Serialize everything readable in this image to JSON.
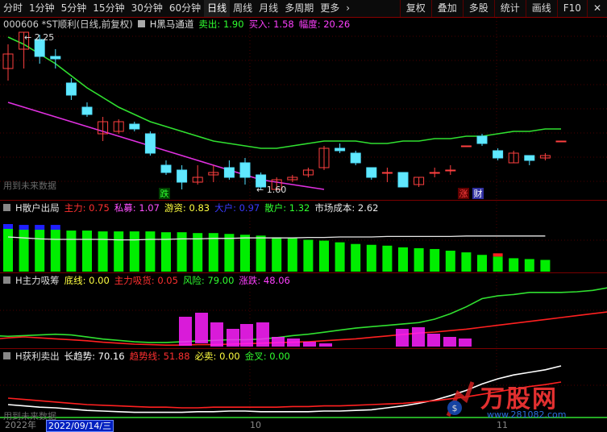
{
  "toolbar": {
    "periods": [
      "分时",
      "1分钟",
      "5分钟",
      "15分钟",
      "30分钟",
      "60分钟",
      "日线",
      "周线",
      "月线",
      "多周期",
      "更多"
    ],
    "active_period": "日线",
    "more_arrow": "›",
    "right_buttons": [
      "复权",
      "叠加",
      "多股",
      "统计",
      "画线",
      "F10"
    ],
    "close": "✕"
  },
  "main_panel": {
    "stock": "000606 *ST顺利(日线,前复权)",
    "indicator": "H黑马通道",
    "sell_label": "卖出: 1.90",
    "buy_label": "买入: 1.58",
    "range_label": "幅度: 20.26",
    "high_mark": "2.25",
    "low_mark": "1.60",
    "tag_die": "跌",
    "tag_zhang": "涨",
    "tag_cai": "财",
    "watermark": "用到未来数据"
  },
  "panel2": {
    "title": "H散户出局",
    "items": [
      {
        "label": "主力: 0.75",
        "color": "#ff3030"
      },
      {
        "label": "私募: 1.07",
        "color": "#ff50ff"
      },
      {
        "label": "游资: 0.83",
        "color": "#ffff40"
      },
      {
        "label": "大户: 0.97",
        "color": "#3a3aff"
      },
      {
        "label": "散户: 1.32",
        "color": "#30ff30"
      },
      {
        "label": "市场成本: 2.62",
        "color": "#e8e8e8"
      }
    ]
  },
  "panel3": {
    "title": "H主力吸筹",
    "items": [
      {
        "label": "底线: 0.00",
        "color": "#ffff40"
      },
      {
        "label": "主力吸货: 0.05",
        "color": "#ff3030"
      },
      {
        "label": "风险: 79.00",
        "color": "#30ff30"
      },
      {
        "label": "涨跌: 48.06",
        "color": "#ff40ff"
      }
    ]
  },
  "panel4": {
    "title": "H获利卖出",
    "items": [
      {
        "label": "长趋势: 70.16",
        "color": "#ffffff"
      },
      {
        "label": "趋势线: 51.88",
        "color": "#ff3030"
      },
      {
        "label": "必卖: 0.00",
        "color": "#ffff40"
      },
      {
        "label": "金叉: 0.00",
        "color": "#30ff30"
      }
    ],
    "watermark": "用到未来数据"
  },
  "footer": {
    "year": "2022年",
    "date": "2022/09/14/三",
    "month_mark": "10",
    "month_mark2": "11"
  },
  "logo": {
    "brand": "万股网",
    "url": "www.281082.com"
  },
  "chart_data": {
    "type": "candlestick",
    "candles": [
      {
        "o": 2.1,
        "c": 2.16,
        "h": 2.2,
        "l": 2.05
      },
      {
        "o": 2.18,
        "c": 2.25,
        "h": 2.25,
        "l": 2.1
      },
      {
        "o": 2.22,
        "c": 2.15,
        "h": 2.24,
        "l": 2.12
      },
      {
        "o": 2.15,
        "c": 2.14,
        "h": 2.18,
        "l": 2.1
      },
      {
        "o": 2.04,
        "c": 1.99,
        "h": 2.06,
        "l": 1.97
      },
      {
        "o": 1.94,
        "c": 1.91,
        "h": 1.96,
        "l": 1.9
      },
      {
        "o": 1.83,
        "c": 1.88,
        "h": 1.9,
        "l": 1.8
      },
      {
        "o": 1.84,
        "c": 1.88,
        "h": 1.89,
        "l": 1.83
      },
      {
        "o": 1.87,
        "c": 1.85,
        "h": 1.88,
        "l": 1.84
      },
      {
        "o": 1.83,
        "c": 1.75,
        "h": 1.84,
        "l": 1.74
      },
      {
        "o": 1.7,
        "c": 1.67,
        "h": 1.72,
        "l": 1.66
      },
      {
        "o": 1.68,
        "c": 1.63,
        "h": 1.7,
        "l": 1.6
      },
      {
        "o": 1.63,
        "c": 1.65,
        "h": 1.7,
        "l": 1.62
      },
      {
        "o": 1.66,
        "c": 1.67,
        "h": 1.7,
        "l": 1.63
      },
      {
        "o": 1.69,
        "c": 1.65,
        "h": 1.72,
        "l": 1.64
      },
      {
        "o": 1.71,
        "c": 1.65,
        "h": 1.73,
        "l": 1.62
      },
      {
        "o": 1.66,
        "c": 1.61,
        "h": 1.67,
        "l": 1.6
      },
      {
        "o": 1.6,
        "c": 1.64,
        "h": 1.65,
        "l": 1.6
      },
      {
        "o": 1.64,
        "c": 1.65,
        "h": 1.66,
        "l": 1.63
      },
      {
        "o": 1.66,
        "c": 1.68,
        "h": 1.69,
        "l": 1.65
      },
      {
        "o": 1.69,
        "c": 1.77,
        "h": 1.78,
        "l": 1.68
      },
      {
        "o": 1.77,
        "c": 1.76,
        "h": 1.79,
        "l": 1.75
      },
      {
        "o": 1.75,
        "c": 1.71,
        "h": 1.76,
        "l": 1.7
      },
      {
        "o": 1.69,
        "c": 1.65,
        "h": 1.69,
        "l": 1.64
      },
      {
        "o": 1.67,
        "c": 1.67,
        "h": 1.69,
        "l": 1.63
      },
      {
        "o": 1.67,
        "c": 1.61,
        "h": 1.67,
        "l": 1.61
      },
      {
        "o": 1.62,
        "c": 1.65,
        "h": 1.65,
        "l": 1.61
      },
      {
        "o": 1.67,
        "c": 1.67,
        "h": 1.69,
        "l": 1.65
      },
      {
        "o": 1.68,
        "c": 1.68,
        "h": 1.7,
        "l": 1.66
      },
      {
        "o": 1.78,
        "c": 1.78,
        "h": 1.78,
        "l": 1.78
      },
      {
        "o": 1.82,
        "c": 1.79,
        "h": 1.83,
        "l": 1.78
      },
      {
        "o": 1.76,
        "c": 1.73,
        "h": 1.77,
        "l": 1.72
      },
      {
        "o": 1.71,
        "c": 1.75,
        "h": 1.76,
        "l": 1.71
      },
      {
        "o": 1.74,
        "c": 1.72,
        "h": 1.74,
        "l": 1.7
      },
      {
        "o": 1.73,
        "c": 1.74,
        "h": 1.75,
        "l": 1.72
      },
      {
        "o": 1.8,
        "c": 1.8,
        "h": 1.8,
        "l": 1.8
      }
    ],
    "channel_upper": [
      2.23,
      2.2,
      2.16,
      2.12,
      2.07,
      2.02,
      1.98,
      1.94,
      1.91,
      1.88,
      1.86,
      1.84,
      1.82,
      1.8,
      1.79,
      1.78,
      1.77,
      1.77,
      1.78,
      1.79,
      1.8,
      1.8,
      1.8,
      1.79,
      1.79,
      1.8,
      1.8,
      1.81,
      1.81,
      1.82,
      1.82,
      1.83,
      1.84,
      1.84,
      1.85,
      1.85
    ],
    "channel_lower": [
      1.96,
      1.94,
      1.92,
      1.9,
      1.88,
      1.86,
      1.84,
      1.82,
      1.8,
      1.78,
      1.76,
      1.74,
      1.72,
      1.7,
      1.68,
      1.66,
      1.64,
      1.63,
      1.62,
      1.61,
      1.6
    ],
    "cost_line": [
      2.6,
      2.58,
      2.56,
      2.55,
      2.55,
      2.55,
      2.55,
      2.54,
      2.54,
      2.55,
      2.55,
      2.56,
      2.56,
      2.57,
      2.57,
      2.58,
      2.58,
      2.58,
      2.58,
      2.59,
      2.59,
      2.6,
      2.6,
      2.6,
      2.61,
      2.61,
      2.61,
      2.61,
      2.61,
      2.62,
      2.62,
      2.62,
      2.62,
      2.62,
      2.62
    ],
    "retail_bars": [
      0.96,
      0.95,
      0.95,
      0.95,
      0.94,
      0.94,
      0.93,
      0.93,
      0.93,
      0.93,
      0.92,
      0.92,
      0.91,
      0.91,
      0.9,
      0.89,
      0.88,
      0.86,
      0.85,
      0.83,
      0.82,
      0.8,
      0.78,
      0.77,
      0.76,
      0.74,
      0.73,
      0.72,
      0.7,
      0.68,
      0.65,
      0.63,
      0.61,
      0.6,
      0.59
    ],
    "risk": [
      18,
      16,
      15,
      16,
      17,
      18,
      17,
      14,
      11,
      9,
      7,
      6,
      6,
      7,
      8,
      9,
      10,
      10,
      11,
      13,
      16,
      18,
      21,
      24,
      27,
      29,
      31,
      33,
      35,
      40,
      48,
      58,
      70,
      74,
      76,
      79,
      79,
      79,
      80,
      82,
      86
    ],
    "main_absorb": [
      10,
      15,
      18,
      20,
      18,
      16,
      14,
      12,
      9,
      7,
      5,
      4,
      3,
      3,
      4,
      4,
      5,
      6,
      7,
      8,
      9,
      10,
      12,
      14,
      16,
      19,
      22,
      25,
      28,
      30,
      33,
      36,
      40,
      44,
      48,
      52,
      56,
      60,
      64,
      68,
      72
    ],
    "long_trend": [
      20,
      18,
      16,
      15,
      13,
      11,
      10,
      9,
      8,
      8,
      8,
      8,
      9,
      9,
      10,
      10,
      9,
      9,
      9,
      9,
      10,
      10,
      11,
      12,
      15,
      18,
      22,
      27,
      34,
      42,
      52,
      60,
      66,
      70,
      74,
      80
    ],
    "trend_line": [
      30,
      28,
      26,
      24,
      22,
      20,
      19,
      18,
      17,
      16,
      16,
      15,
      15,
      16,
      16,
      16,
      16,
      16,
      17,
      17,
      18,
      18,
      19,
      20,
      21,
      22,
      24,
      26,
      29,
      32,
      36,
      40,
      44,
      48,
      51,
      55
    ]
  }
}
